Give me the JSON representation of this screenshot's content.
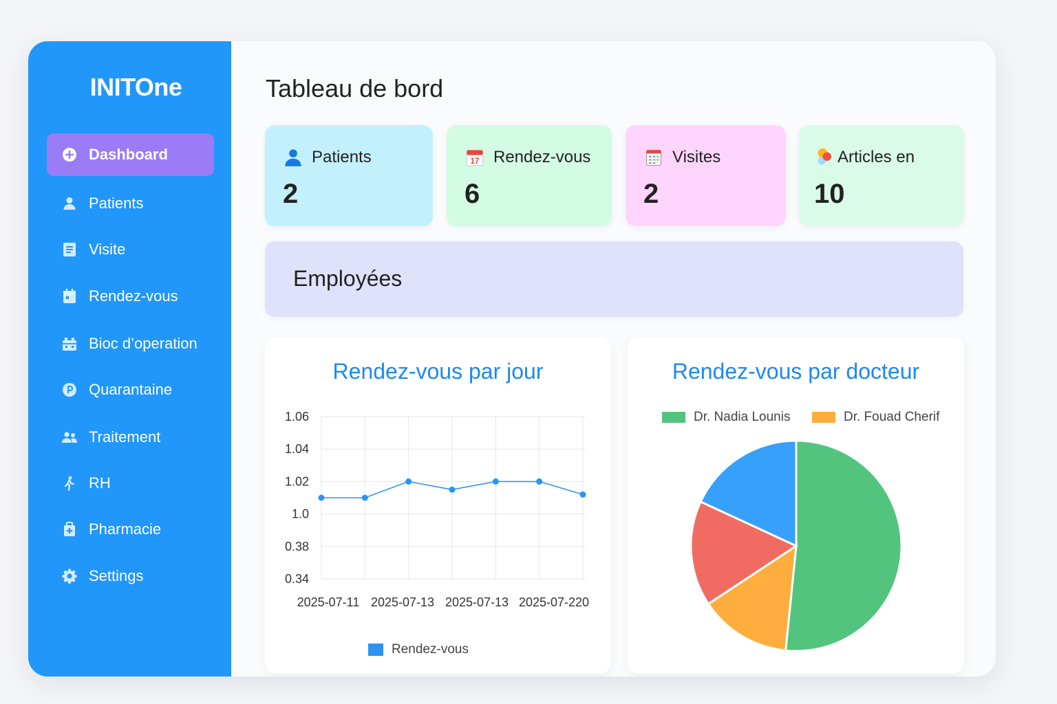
{
  "app": {
    "brand": "INITOne"
  },
  "sidebar": {
    "items": [
      {
        "label": "Dashboard",
        "icon": "plus-circle-icon",
        "active": true
      },
      {
        "label": "Patients",
        "icon": "user-icon"
      },
      {
        "label": "Visite",
        "icon": "document-icon"
      },
      {
        "label": "Rendez-vous",
        "icon": "calendar-icon"
      },
      {
        "label": "Bioc d’operation",
        "icon": "operating-block-icon"
      },
      {
        "label": "Quarantaine",
        "icon": "quarantine-icon"
      },
      {
        "label": "Traitement",
        "icon": "users-icon"
      },
      {
        "label": "RH",
        "icon": "person-walking-icon"
      },
      {
        "label": "Pharmacie",
        "icon": "medical-kit-icon"
      },
      {
        "label": "Settings",
        "icon": "gear-icon"
      }
    ]
  },
  "main": {
    "title": "Tableau de bord",
    "cards": [
      {
        "label": "Patients",
        "value": "2",
        "icon": "user-icon",
        "color": "#c3f0fd"
      },
      {
        "label": "Rendez-vous",
        "value": "6",
        "icon": "calendar-icon",
        "color": "#d4fbe4"
      },
      {
        "label": "Visites",
        "value": "2",
        "icon": "calendar-icon",
        "color": "#ffd5fd"
      },
      {
        "label": "Articles en",
        "value": "10",
        "icon": "dots-icon",
        "color": "#d9fbe7"
      }
    ],
    "employees_label": "Employées"
  },
  "charts": {
    "line_title": "Rendez-vous par jour",
    "pie_title": "Rendez-vous par docteur"
  },
  "chart_data": [
    {
      "type": "line",
      "title": "Rendez-vous par jour",
      "y_tick_labels": [
        "1.06",
        "1.04",
        "1.02",
        "1.0",
        "0.38",
        "0.34"
      ],
      "x_tick_labels": [
        "2025-07-11",
        "2025-07-13",
        "2025-07-13",
        "2025-07-220"
      ],
      "series": [
        {
          "name": "Rendez-vous",
          "color": "#2d93f3",
          "values": [
            1.01,
            1.01,
            1.02,
            1.015,
            1.02,
            1.02,
            1.012
          ]
        }
      ],
      "ylim": [
        0.34,
        1.06
      ],
      "grid": true,
      "legend": "bottom"
    },
    {
      "type": "pie",
      "title": "Rendez-vous par docteur",
      "legend_entries": [
        {
          "name": "Dr. Nadia Lounis",
          "color": "#52c47e"
        },
        {
          "name": "Dr. Fouad Cherif",
          "color": "#ffae3d"
        }
      ],
      "slices": [
        {
          "value": 51.6,
          "color": "#52c47e"
        },
        {
          "value": 14.1,
          "color": "#ffae3d"
        },
        {
          "value": 16.2,
          "color": "#f06c62"
        },
        {
          "value": 18.1,
          "color": "#37a0fb"
        }
      ],
      "legend": "top"
    }
  ]
}
